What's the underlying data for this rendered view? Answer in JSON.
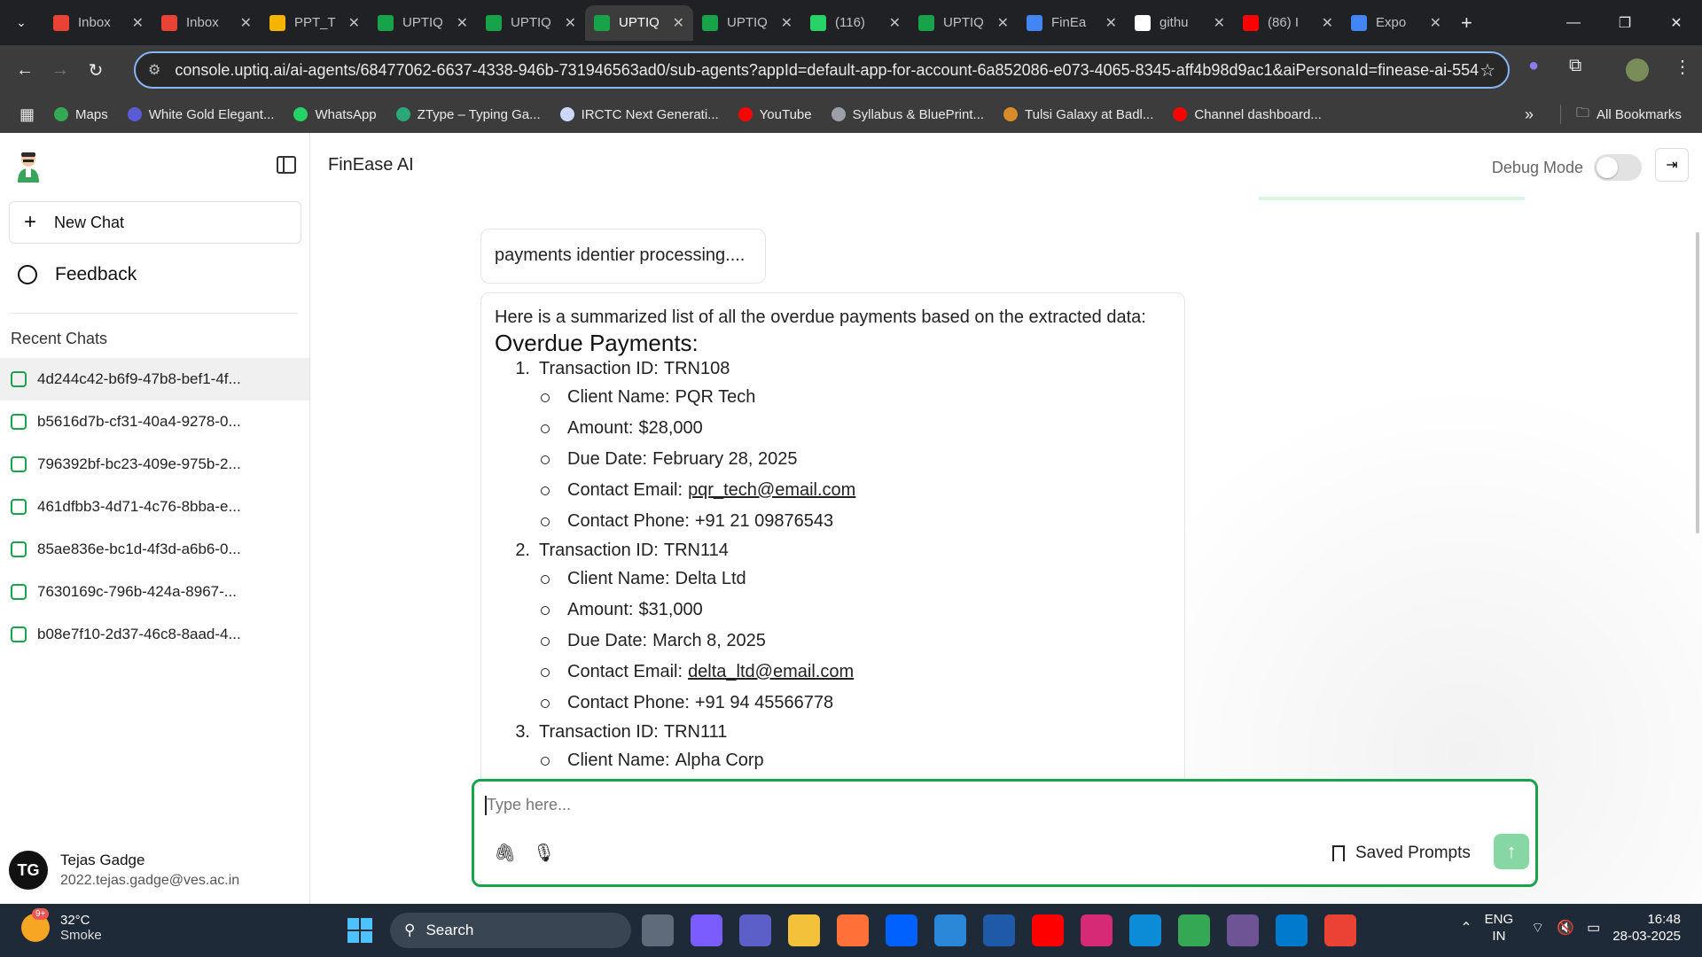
{
  "browser": {
    "tabs": [
      {
        "title": "Inbox",
        "icon": "gmail-icon",
        "color": "#ea4335",
        "active": false
      },
      {
        "title": "Inbox",
        "icon": "gmail-icon",
        "color": "#ea4335",
        "active": false
      },
      {
        "title": "PPT_T",
        "icon": "slides-icon",
        "color": "#f4b400",
        "active": false
      },
      {
        "title": "UPTIQ",
        "icon": "uptiq-icon",
        "color": "#16a34a",
        "active": false
      },
      {
        "title": "UPTIQ",
        "icon": "uptiq-icon",
        "color": "#16a34a",
        "active": false
      },
      {
        "title": "UPTIQ",
        "icon": "uptiq-icon",
        "color": "#16a34a",
        "active": true
      },
      {
        "title": "UPTIQ",
        "icon": "uptiq-icon",
        "color": "#16a34a",
        "active": false
      },
      {
        "title": "(116)",
        "icon": "whatsapp-icon",
        "color": "#25d366",
        "active": false
      },
      {
        "title": "UPTIQ",
        "icon": "uptiq-icon",
        "color": "#16a34a",
        "active": false
      },
      {
        "title": "FinEa",
        "icon": "docs-icon",
        "color": "#4285f4",
        "active": false
      },
      {
        "title": "githu",
        "icon": "google-icon",
        "color": "#ffffff",
        "active": false
      },
      {
        "title": "(86) I",
        "icon": "youtube-icon",
        "color": "#ff0000",
        "active": false
      },
      {
        "title": "Expo",
        "icon": "docs-icon",
        "color": "#4285f4",
        "active": false
      }
    ],
    "url": "console.uptiq.ai/ai-agents/68477062-6637-4338-946b-731946563ad0/sub-agents?appId=default-app-for-account-6a852086-e073-4065-8345-aff4b98d9ac1&aiPersonaId=finease-ai-554...",
    "bookmarks": [
      {
        "label": "Maps",
        "color": "#34a853"
      },
      {
        "label": "White Gold Elegant...",
        "color": "#5b5bd6"
      },
      {
        "label": "WhatsApp",
        "color": "#25d366"
      },
      {
        "label": "ZType – Typing Ga...",
        "color": "#2aa876"
      },
      {
        "label": "IRCTC Next Generati...",
        "color": "#cfd8ff"
      },
      {
        "label": "YouTube",
        "color": "#ff0000"
      },
      {
        "label": "Syllabus & BluePrint...",
        "color": "#9aa0a6"
      },
      {
        "label": "Tulsi Galaxy at Badl...",
        "color": "#d88b2a"
      },
      {
        "label": "Channel dashboard...",
        "color": "#ff0000"
      }
    ],
    "all_bookmarks": "All Bookmarks"
  },
  "sidebar": {
    "new_chat": "New Chat",
    "feedback": "Feedback",
    "recent_heading": "Recent Chats",
    "chats": [
      "4d244c42-b6f9-47b8-bef1-4f...",
      "b5616d7b-cf31-40a4-9278-0...",
      "796392bf-bc23-409e-975b-2...",
      "461dfbb3-4d71-4c76-8bba-e...",
      "85ae836e-bc1d-4f3d-a6b6-0...",
      "7630169c-796b-424a-8967-...",
      "b08e7f10-2d37-46c8-8aad-4..."
    ],
    "user": {
      "initials": "TG",
      "name": "Tejas Gadge",
      "email": "2022.tejas.gadge@ves.ac.in"
    }
  },
  "header": {
    "title": "FinEase AI",
    "debug_label": "Debug Mode"
  },
  "conversation": {
    "status_message": "payments identier processing....",
    "intro": "Here is a summarized list of all the overdue payments based on the extracted data:",
    "heading": "Overdue Payments:",
    "transactions": [
      {
        "num": "1.",
        "id_label": "Transaction ID:",
        "id": "TRN108",
        "fields": [
          {
            "label": "Client Name:",
            "value": "PQR Tech",
            "link": false
          },
          {
            "label": "Amount:",
            "value": "$28,000",
            "link": false
          },
          {
            "label": "Due Date:",
            "value": "February 28, 2025",
            "link": false
          },
          {
            "label": "Contact Email:",
            "value": "pqr_tech@email.com",
            "link": true
          },
          {
            "label": "Contact Phone:",
            "value": "+91 21 09876543",
            "link": false
          }
        ]
      },
      {
        "num": "2.",
        "id_label": "Transaction ID:",
        "id": "TRN114",
        "fields": [
          {
            "label": "Client Name:",
            "value": "Delta Ltd",
            "link": false
          },
          {
            "label": "Amount:",
            "value": "$31,000",
            "link": false
          },
          {
            "label": "Due Date:",
            "value": "March 8, 2025",
            "link": false
          },
          {
            "label": "Contact Email:",
            "value": "delta_ltd@email.com",
            "link": true
          },
          {
            "label": "Contact Phone:",
            "value": "+91 94 45566778",
            "link": false
          }
        ]
      },
      {
        "num": "3.",
        "id_label": "Transaction ID:",
        "id": "TRN111",
        "fields": [
          {
            "label": "Client Name:",
            "value": "Alpha Corp",
            "link": false
          }
        ]
      }
    ]
  },
  "composer": {
    "placeholder": "Type here...",
    "saved_prompts": "Saved Prompts"
  },
  "taskbar": {
    "temp": "32°C",
    "condition": "Smoke",
    "weather_badge": "9+",
    "search": "Search",
    "lang_top": "ENG",
    "lang_bottom": "IN",
    "time": "16:48",
    "date": "28-03-2025",
    "apps": [
      {
        "icon": "task-view-icon",
        "color": "#5f6b7a"
      },
      {
        "icon": "copilot-icon",
        "color": "#7a5cff"
      },
      {
        "icon": "teams-icon",
        "color": "#5b5fc7"
      },
      {
        "icon": "file-explorer-icon",
        "color": "#f3c13a"
      },
      {
        "icon": "firefox-icon",
        "color": "#ff7139"
      },
      {
        "icon": "dropbox-icon",
        "color": "#0061ff"
      },
      {
        "icon": "store-icon",
        "color": "#2b88d8"
      },
      {
        "icon": "app-icon",
        "color": "#1e5aa8"
      },
      {
        "icon": "youtube-icon",
        "color": "#ff0000"
      },
      {
        "icon": "instagram-icon",
        "color": "#d62976"
      },
      {
        "icon": "edge-icon",
        "color": "#0c8bd6"
      },
      {
        "icon": "chrome-icon",
        "color": "#34a853"
      },
      {
        "icon": "github-icon",
        "color": "#6e5494"
      },
      {
        "icon": "vscode-icon",
        "color": "#007acc"
      },
      {
        "icon": "chrome-profile-icon",
        "color": "#ea4335"
      }
    ]
  }
}
